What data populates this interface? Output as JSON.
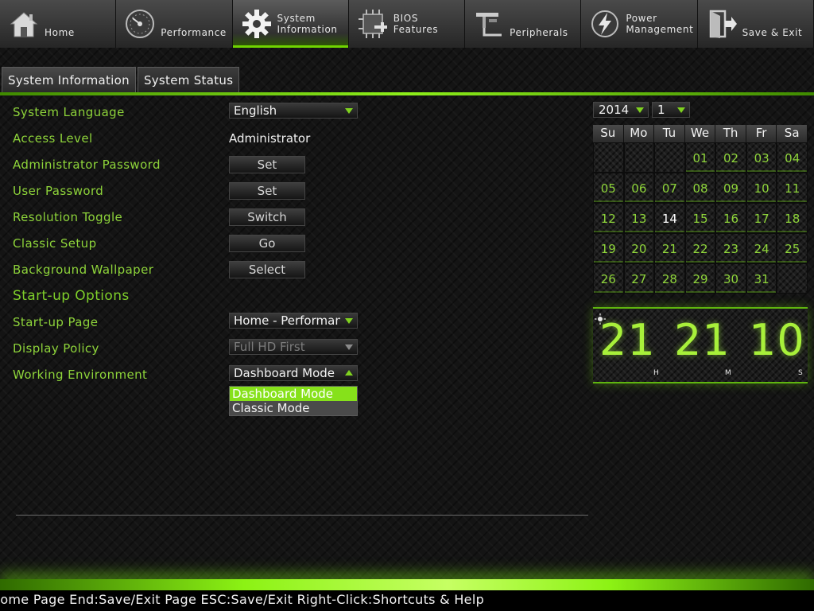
{
  "nav": {
    "items": [
      {
        "label": "Home",
        "icon": "home-icon"
      },
      {
        "label": "Performance",
        "icon": "speedometer-icon"
      },
      {
        "label": "System\nInformation",
        "icon": "gear-icon"
      },
      {
        "label": "BIOS\nFeatures",
        "icon": "chip-icon"
      },
      {
        "label": "Peripherals",
        "icon": "peripherals-icon"
      },
      {
        "label": "Power\nManagement",
        "icon": "power-icon"
      },
      {
        "label": "Save & Exit",
        "icon": "exit-door-icon"
      }
    ],
    "active": "System Information"
  },
  "tabs": [
    {
      "label": "System Information"
    },
    {
      "label": "System Status"
    }
  ],
  "settings": {
    "system_language": {
      "label": "System Language",
      "value": "English"
    },
    "access_level": {
      "label": "Access Level",
      "value": "Administrator"
    },
    "admin_password": {
      "label": "Administrator Password",
      "button": "Set"
    },
    "user_password": {
      "label": "User Password",
      "button": "Set"
    },
    "resolution_toggle": {
      "label": "Resolution Toggle",
      "button": "Switch"
    },
    "classic_setup": {
      "label": "Classic Setup",
      "button": "Go"
    },
    "background_wallpaper": {
      "label": "Background Wallpaper",
      "button": "Select"
    },
    "startup_options": {
      "label": "Start-up Options"
    },
    "startup_page": {
      "label": "Start-up Page",
      "value": "Home - Performance"
    },
    "display_policy": {
      "label": "Display Policy",
      "value": "Full HD First"
    },
    "working_environment": {
      "label": "Working Environment",
      "value": "Dashboard Mode",
      "options": [
        "Dashboard Mode",
        "Classic Mode"
      ]
    }
  },
  "calendar": {
    "year": "2014",
    "month": "1",
    "day_names": [
      "Su",
      "Mo",
      "Tu",
      "We",
      "Th",
      "Fr",
      "Sa"
    ],
    "first_weekday": 3,
    "days": [
      "01",
      "02",
      "03",
      "04",
      "05",
      "06",
      "07",
      "08",
      "09",
      "10",
      "11",
      "12",
      "13",
      "14",
      "15",
      "16",
      "17",
      "18",
      "19",
      "20",
      "21",
      "22",
      "23",
      "24",
      "25",
      "26",
      "27",
      "28",
      "29",
      "30",
      "31"
    ],
    "today": "14"
  },
  "clock": {
    "hours": "21",
    "minutes": "21",
    "seconds": "10",
    "unit_h": "H",
    "unit_m": "M",
    "unit_s": "S"
  },
  "footer": {
    "text": "Home Page End:Save/Exit Page ESC:Save/Exit Right-Click:Shortcuts & Help"
  },
  "colors": {
    "accent": "#8ed43a",
    "bright_accent": "#86e11a",
    "background": "#141414"
  }
}
